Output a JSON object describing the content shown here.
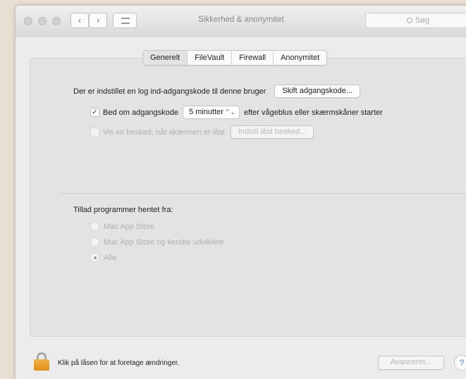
{
  "window": {
    "title": "Sikkerhed & anonymitet",
    "search_placeholder": "Søg"
  },
  "tabs": [
    {
      "label": "Generelt",
      "selected": true
    },
    {
      "label": "FileVault",
      "selected": false
    },
    {
      "label": "Firewall",
      "selected": false
    },
    {
      "label": "Anonymitet",
      "selected": false
    }
  ],
  "general": {
    "password_text": "Der er indstillet en log ind-adgangskode til denne bruger",
    "change_password_button": "Skift adgangskode...",
    "require_password": {
      "checked": true,
      "label": "Bed om adgangskode",
      "interval": "5 minutter",
      "suffix": "efter vågeblus eller skærmskåner starter"
    },
    "show_message": {
      "checked": false,
      "label": "Vis en besked, når skærmen er låst",
      "button": "Indstil låst besked..."
    }
  },
  "allow_apps": {
    "heading": "Tillad programmer hentet fra:",
    "options": [
      {
        "label": "Mac App Store",
        "selected": false
      },
      {
        "label": "Mac App Store og kendte udviklere",
        "selected": false
      },
      {
        "label": "Alle",
        "selected": true
      }
    ]
  },
  "footer": {
    "lock_text": "Klik på låsen for at foretage ændringer.",
    "advanced_button": "Avanceret...",
    "help_glyph": "?"
  },
  "checkmark_glyph": "✓",
  "popup_arrow_glyph": "⌃⌄"
}
